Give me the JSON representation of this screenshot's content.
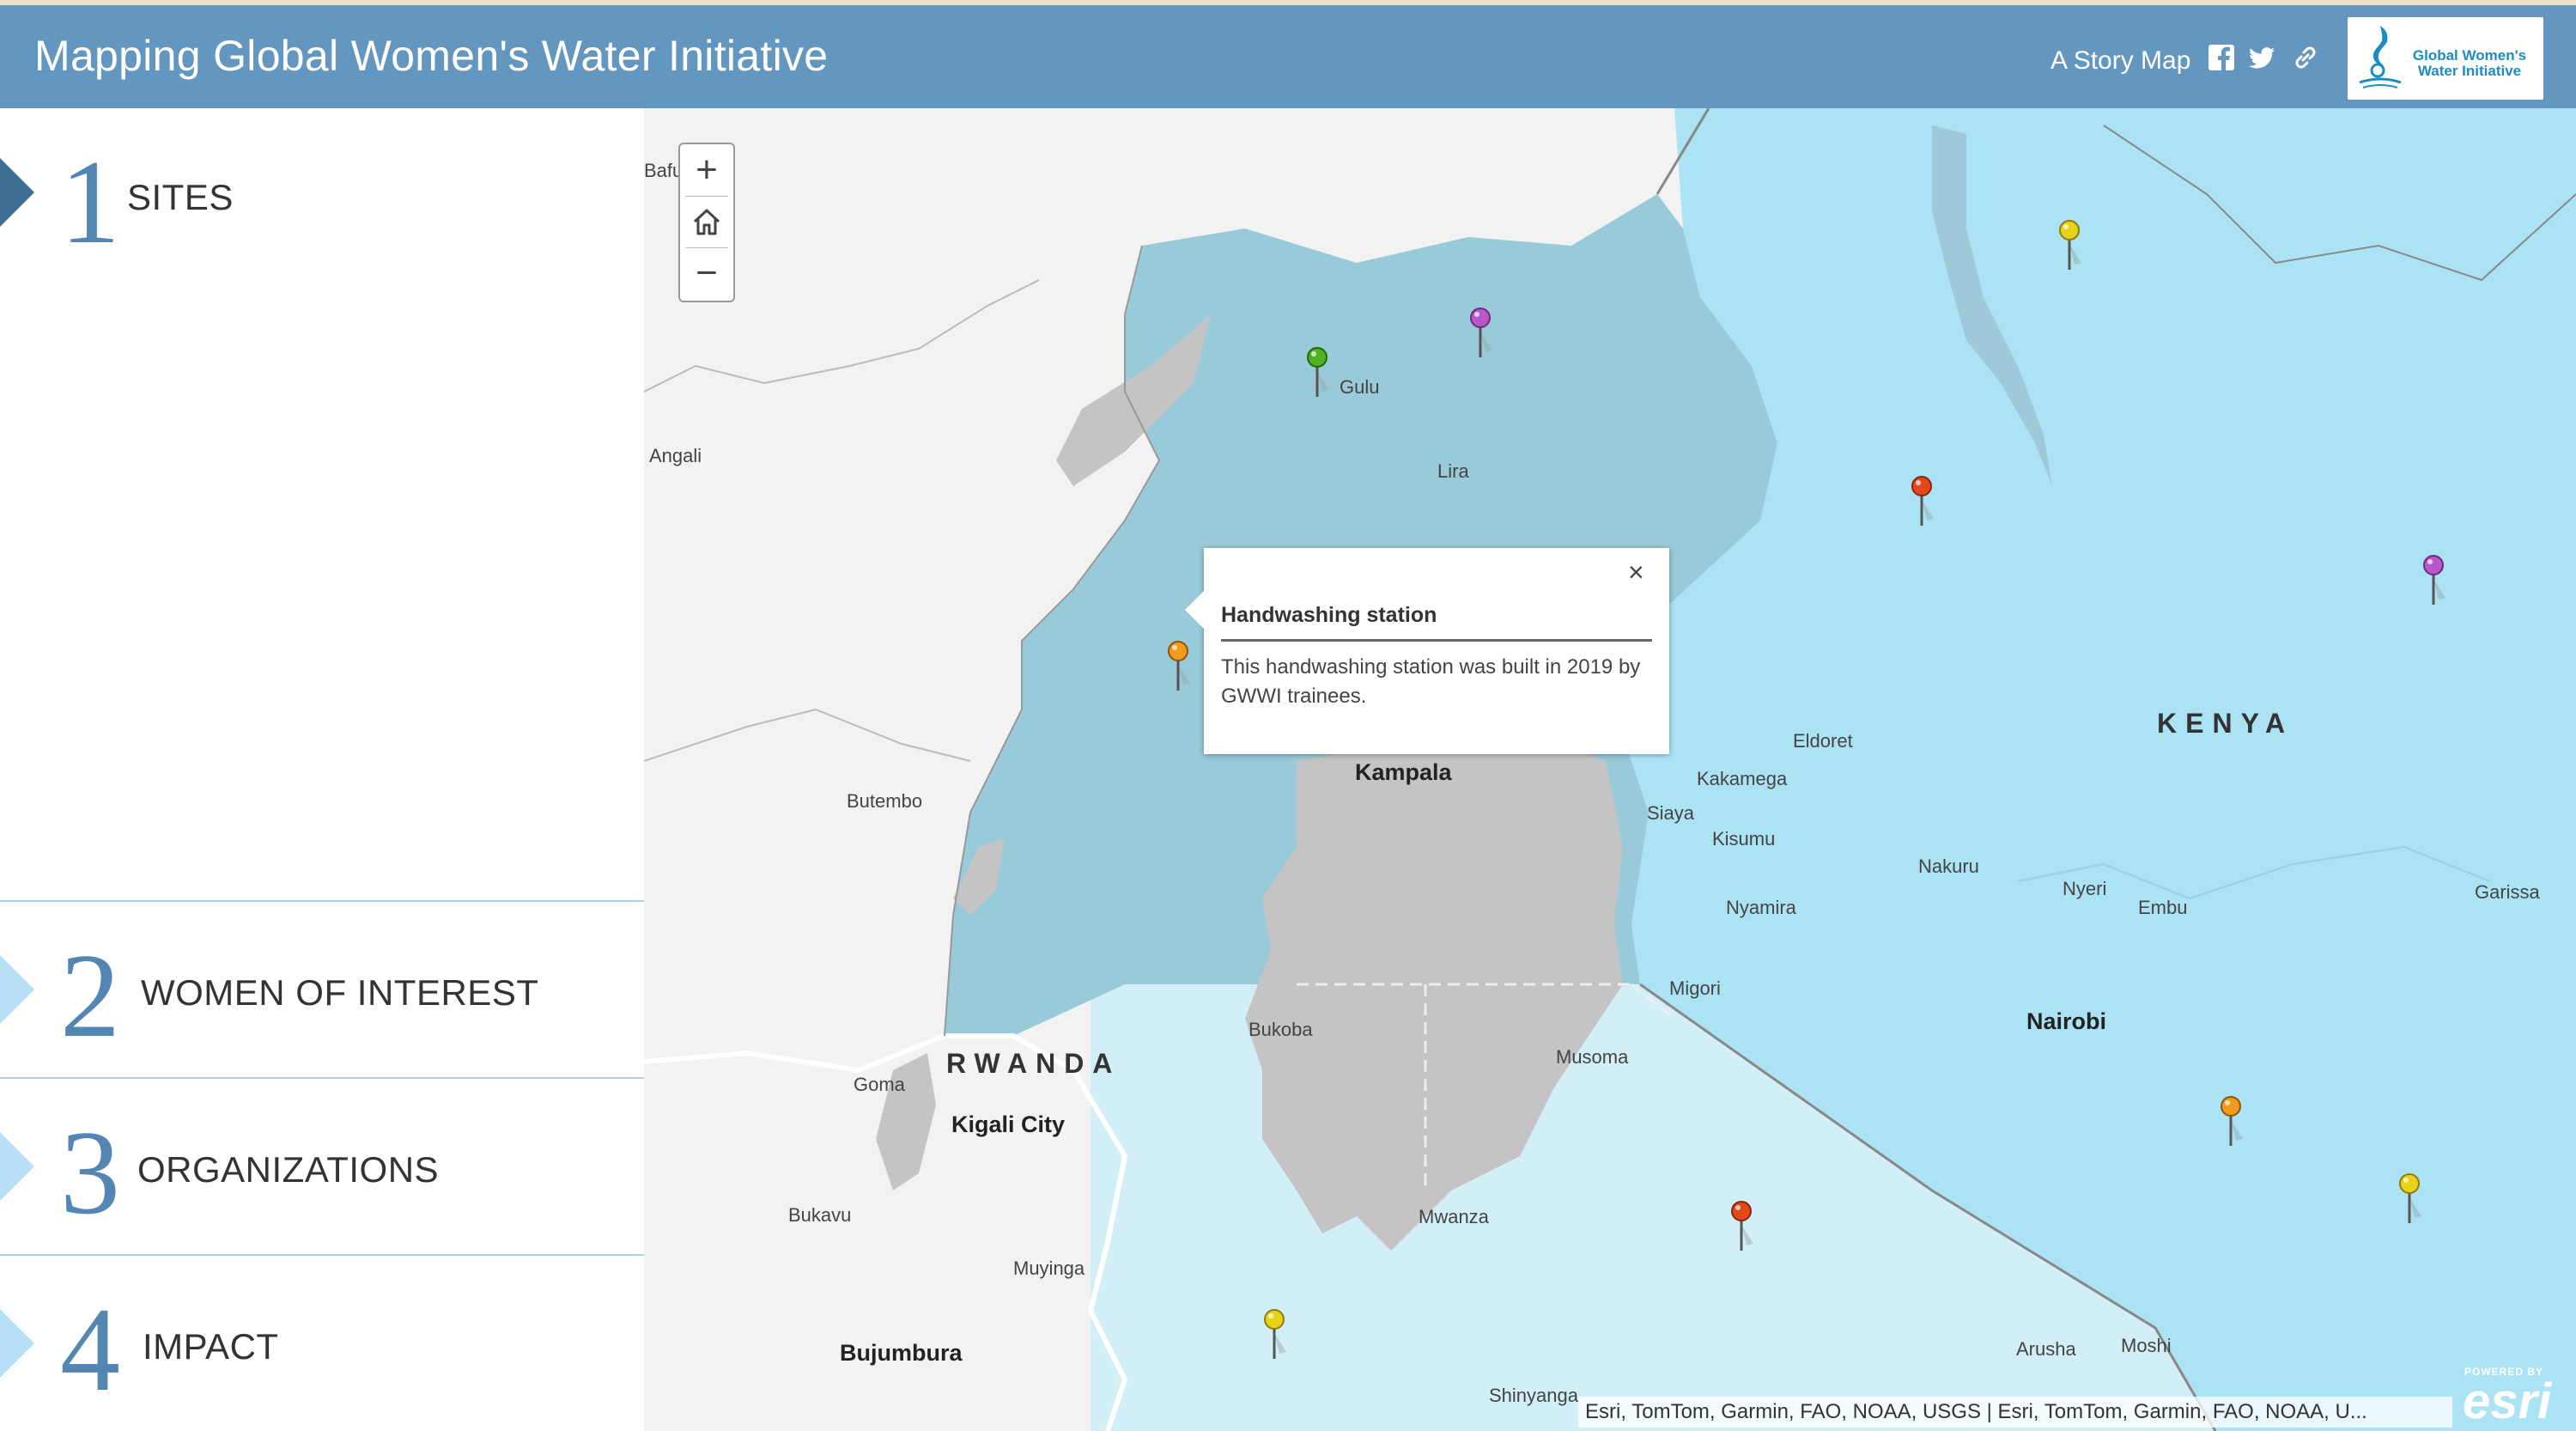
{
  "header": {
    "title": "Mapping Global Women's Water Initiative",
    "tagline": "A Story Map",
    "share_icons": [
      "facebook-icon",
      "twitter-icon",
      "link-icon"
    ],
    "logo_text": "Global Women's Water Initiative"
  },
  "sidebar": {
    "sections": [
      {
        "number": "1",
        "label": "SITES",
        "active": true
      },
      {
        "number": "2",
        "label": "WOMEN OF INTEREST",
        "active": false
      },
      {
        "number": "3",
        "label": "ORGANIZATIONS",
        "active": false
      },
      {
        "number": "4",
        "label": "IMPACT",
        "active": false
      }
    ]
  },
  "map": {
    "zoom_controls": {
      "zoom_in": "+",
      "zoom_out": "−",
      "home_icon": "home-icon"
    },
    "places": {
      "bafu": "Bafu",
      "angali": "Angali",
      "gulu": "Gulu",
      "lira": "Lira",
      "butembo": "Butembo",
      "kampala": "Kampala",
      "eldoret": "Eldoret",
      "kakamega": "Kakamega",
      "siaya": "Siaya",
      "kisumu": "Kisumu",
      "nakuru": "Nakuru",
      "nyeri": "Nyeri",
      "embu": "Embu",
      "garissa": "Garissa",
      "nyamira": "Nyamira",
      "migori": "Migori",
      "nairobi": "Nairobi",
      "kenya": "KENYA",
      "rwanda": "RWANDA",
      "goma": "Goma",
      "kigali": "Kigali City",
      "bukoba": "Bukoba",
      "musoma": "Musoma",
      "mwanza": "Mwanza",
      "bukavu": "Bukavu",
      "muyinga": "Muyinga",
      "bujumbura": "Bujumbura",
      "arusha": "Arusha",
      "moshi": "Moshi",
      "shinyanga": "Shinyanga"
    },
    "pins": [
      {
        "color": "#e8d21a",
        "name": "pin-yellow"
      },
      {
        "color": "#b857c9",
        "name": "pin-purple"
      },
      {
        "color": "#4fb31f",
        "name": "pin-green"
      },
      {
        "color": "#e2481a",
        "name": "pin-red"
      },
      {
        "color": "#b857c9",
        "name": "pin-purple"
      },
      {
        "color": "#f19a1b",
        "name": "pin-orange"
      },
      {
        "color": "#f19a1b",
        "name": "pin-orange"
      },
      {
        "color": "#e8d21a",
        "name": "pin-yellow"
      },
      {
        "color": "#e2481a",
        "name": "pin-red"
      },
      {
        "color": "#e8d21a",
        "name": "pin-yellow"
      }
    ],
    "popup": {
      "title": "Handwashing station",
      "body": "This handwashing station was built in 2019 by GWWI trainees.",
      "close": "×"
    },
    "attribution": "Esri, TomTom, Garmin, FAO, NOAA, USGS | Esri, TomTom, Garmin, FAO, NOAA, U...",
    "esri_powered": "POWERED BY",
    "esri_wordmark": "esri"
  },
  "colors": {
    "header": "#6497bf",
    "uganda": "#99cad9",
    "kenya": "#abe3f5",
    "tanzania": "#d2eef7",
    "lake": "#c4c4c4"
  }
}
